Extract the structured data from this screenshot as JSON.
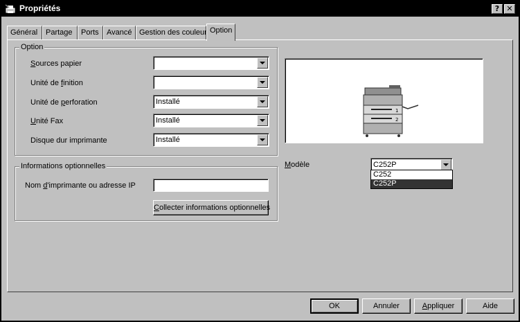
{
  "window": {
    "title": "Propriétés",
    "help_button": "?",
    "close_button": "✕"
  },
  "tabs": [
    {
      "label": "Général"
    },
    {
      "label": "Partage"
    },
    {
      "label": "Ports"
    },
    {
      "label": "Avancé"
    },
    {
      "label": "Gestion des couleurs"
    },
    {
      "label": "Option"
    }
  ],
  "option_group": {
    "legend": "Option",
    "rows": [
      {
        "label_prefix": "",
        "label_mnemonic": "S",
        "label_suffix": "ources papier",
        "value": ""
      },
      {
        "label_prefix": "Unité de ",
        "label_mnemonic": "f",
        "label_suffix": "inition",
        "value": ""
      },
      {
        "label_prefix": "Unité de ",
        "label_mnemonic": "p",
        "label_suffix": "erforation",
        "value": "Installé"
      },
      {
        "label_prefix": "",
        "label_mnemonic": "U",
        "label_suffix": "nité Fax",
        "value": "Installé"
      },
      {
        "label_prefix": "",
        "label_mnemonic": "",
        "label_suffix": "Disque dur imprimante",
        "value": "Installé"
      }
    ]
  },
  "info_group": {
    "legend": "Informations optionnelles",
    "ip_label_prefix": "Nom ",
    "ip_label_mnemonic": "d",
    "ip_label_suffix": "'imprimante ou adresse IP",
    "ip_value": "",
    "collect_mnemonic": "C",
    "collect_label": "ollecter informations optionnelles"
  },
  "model": {
    "label_mnemonic": "M",
    "label_suffix": "odèle",
    "value": "C252P",
    "options": [
      "C252",
      "C252P"
    ],
    "selected_index": 1
  },
  "printer_tray_labels": [
    "1",
    "2"
  ],
  "footer": {
    "ok": "OK",
    "cancel": "Annuler",
    "apply_mnemonic": "A",
    "apply": "ppliquer",
    "help": "Aide"
  }
}
